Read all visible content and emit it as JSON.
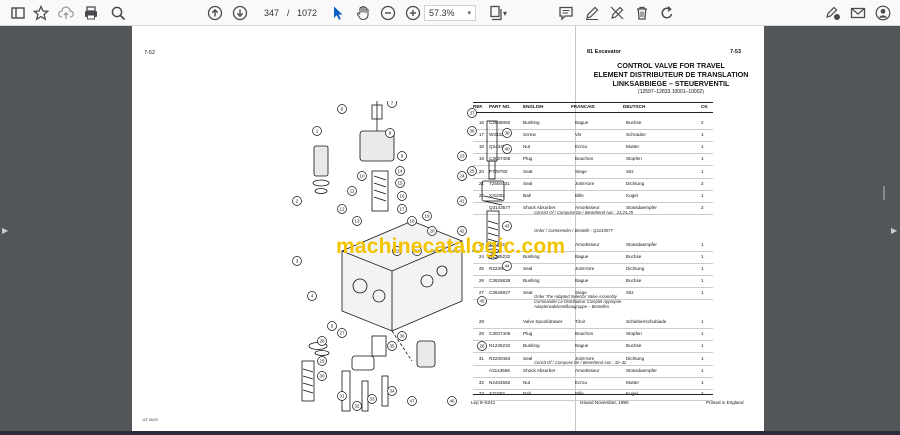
{
  "toolbar": {
    "page_current": "347",
    "page_separator": "/",
    "page_total": "1072",
    "zoom": "57.3%",
    "icons": [
      "bookmark-star-icon",
      "upload-icon",
      "print-icon",
      "search-icon",
      "page-up-icon",
      "page-down-icon",
      "select-cursor-icon",
      "hand-tool-icon",
      "zoom-out-icon",
      "zoom-in-icon",
      "page-fit-icon",
      "comment-icon",
      "draw-icon",
      "erase-icon",
      "delete-icon",
      "rotate-icon",
      "sign-icon",
      "email-icon",
      "account-icon"
    ]
  },
  "left_page": {
    "page_number": "7-52",
    "caption": "JZF 564/0",
    "callouts": [
      "1",
      "2",
      "3",
      "4",
      "5",
      "6",
      "7",
      "8",
      "9",
      "10",
      "11",
      "12",
      "13",
      "14",
      "15",
      "16",
      "17",
      "18",
      "19",
      "20",
      "21",
      "22",
      "23",
      "24",
      "25",
      "26",
      "27",
      "28",
      "29",
      "30",
      "31",
      "32",
      "33",
      "34",
      "35",
      "36",
      "37",
      "38",
      "39",
      "40",
      "41",
      "42",
      "43",
      "44",
      "45",
      "46",
      "47"
    ]
  },
  "right_page": {
    "model": "81 Excavator",
    "page_number": "7-53",
    "title_lines": [
      "CONTROL VALVE FOR TRAVEL",
      "ELEMENT DISTRIBUTEUR DE TRANSLATION",
      "LINKSABBIEGE – STEUERVENTIL"
    ],
    "serial_range": "(12597–12833.10001–10002)",
    "headers": {
      "ref": "REF.",
      "part_no": "PART  NO.",
      "english": "ENGLISH",
      "francais": "FRANCAIS",
      "deutsch": "DEUTSCH",
      "ck": "CK"
    },
    "rows": [
      {
        "ref": "16",
        "part": "C2648060",
        "en": "Bushing",
        "fr": "Bague",
        "de": "Buchse",
        "ck": "2"
      },
      {
        "ref": "17",
        "part": "W3333043",
        "en": "Screw",
        "fr": "Vis",
        "de": "Schraube",
        "ck": "1"
      },
      {
        "ref": "18",
        "part": "Q2434541",
        "en": "Nut",
        "fr": "Ecrou",
        "de": "Mutter",
        "ck": "1"
      },
      {
        "ref": "19",
        "part": "C3037405",
        "en": "Plug",
        "fr": "Bouchon",
        "de": "Stopfen",
        "ck": "1"
      },
      {
        "ref": "20",
        "part": "P729780",
        "en": "Seat",
        "fr": "Siege",
        "de": "Sitz",
        "ck": "1"
      },
      {
        "ref": "21",
        "part": "T2500431",
        "en": "Seal",
        "fr": "Joint-tore",
        "de": "Dichtung",
        "ck": "2"
      },
      {
        "ref": "22",
        "part": "X31002",
        "en": "Ball",
        "fr": "Bille",
        "de": "Kugel",
        "ck": "1"
      },
      {
        "ref": "",
        "part": "Q3143577",
        "en": "Shock Absorber",
        "fr": "Amortisseur",
        "de": "Stossdaempfer",
        "ck": "2"
      },
      {
        "ref": "23",
        "part": "X31002",
        "en": "",
        "fr": "Amortisseur",
        "de": "Stossdaempfer",
        "ck": "1"
      },
      {
        "ref": "24",
        "part": "N1245232",
        "en": "Bushing",
        "fr": "Bague",
        "de": "Buchse",
        "ck": "1"
      },
      {
        "ref": "25",
        "part": "R2230463",
        "en": "Seal",
        "fr": "Joint-tore",
        "de": "Dichtung",
        "ck": "1"
      },
      {
        "ref": "26",
        "part": "C3626838",
        "en": "Bushing",
        "fr": "Bague",
        "de": "Buchse",
        "ck": "1"
      },
      {
        "ref": "27",
        "part": "C3626827",
        "en": "Seat",
        "fr": "Siege",
        "de": "Sitz",
        "ck": "1"
      },
      {
        "ref": "28",
        "part": "",
        "en": "Valve Spool/drawer",
        "fr": "Tiroir",
        "de": "Schieber/schubiade",
        "ck": "1"
      },
      {
        "ref": "29",
        "part": "C3037406",
        "en": "Plug",
        "fr": "Bouchon",
        "de": "Stopfen",
        "ck": "1"
      },
      {
        "ref": "30",
        "part": "N1245232",
        "en": "Bushing",
        "fr": "Bague",
        "de": "Buchse",
        "ck": "1"
      },
      {
        "ref": "31",
        "part": "R2230463",
        "en": "Seal",
        "fr": "Joint-tore",
        "de": "Dichtung",
        "ck": "1"
      },
      {
        "ref": "",
        "part": "A3143566",
        "en": "Shock Absorber",
        "fr": "Amortisseur",
        "de": "Stossdaempfer",
        "ck": "1"
      },
      {
        "ref": "32",
        "part": "N2434562",
        "en": "Nut",
        "fr": "Ecrou",
        "de": "Mutter",
        "ck": "1"
      },
      {
        "ref": "33",
        "part": "X31002",
        "en": "Ball",
        "fr": "Bille",
        "de": "Kugel",
        "ck": "2"
      }
    ],
    "notes": [
      "Consist Of / Compose De / Bestehend Aus : 23,24,25",
      "Order / Commender / Bestelle : Q3143577",
      "Order The Adapted Selector Valve Assembly",
      "Commander Le Distributeur Complet Approprie",
      "Adapterwahlventilbaugruppe – Bestellen",
      "Consit Of / Compose De / Bestehend Aus : 32–42"
    ],
    "footer_left": "Lep 8–5241",
    "footer_mid": "Issued November, 1990",
    "footer_right": "Printed in England"
  },
  "watermark": "machinecatalogic.com"
}
